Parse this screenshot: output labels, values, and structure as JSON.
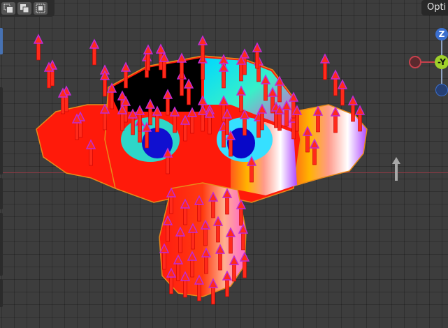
{
  "app": {
    "options_tab_label": "Opti"
  },
  "toolbar": {
    "buttons": [
      {
        "icon": "select-box-icon"
      },
      {
        "icon": "select-extend-icon"
      },
      {
        "icon": "select-subtract-icon"
      }
    ]
  },
  "gizmo": {
    "z_label": "Z",
    "y_label": "-Y",
    "colors": {
      "z": "#3b6fcf",
      "y": "#9fd12a",
      "x": "#c8404c"
    }
  },
  "viewport": {
    "background": "#3d3d3d",
    "x_axis_color": "#8a3a44",
    "normal_arrow_color": "#ff2a1a",
    "normal_arrow_tip_color": "#c02bd8"
  }
}
